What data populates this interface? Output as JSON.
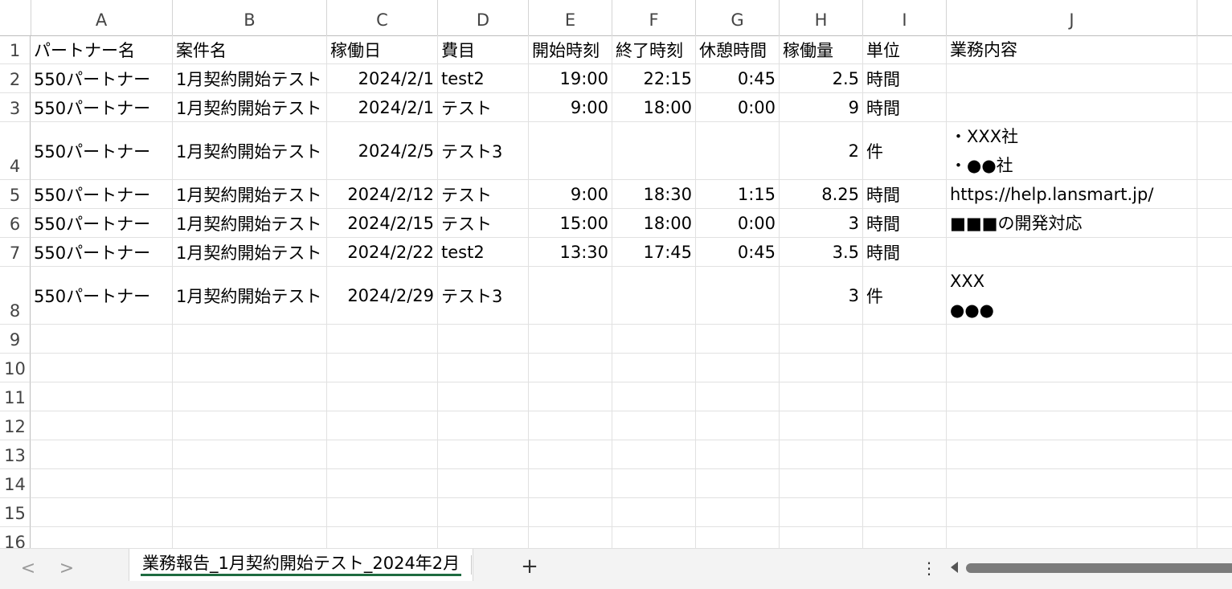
{
  "columns": [
    "A",
    "B",
    "C",
    "D",
    "E",
    "F",
    "G",
    "H",
    "I",
    "J"
  ],
  "rows": [
    {
      "num": "1",
      "cells": [
        "パートナー名",
        "案件名",
        "稼働日",
        "費目",
        "開始時刻",
        "終了時刻",
        "休憩時間",
        "稼働量",
        "単位",
        [
          "業務内容"
        ]
      ]
    },
    {
      "num": "2",
      "cells": [
        "550パートナー",
        "1月契約開始テスト",
        "2024/2/1",
        "test2",
        "19:00",
        "22:15",
        "0:45",
        "2.5",
        "時間",
        []
      ]
    },
    {
      "num": "3",
      "cells": [
        "550パートナー",
        "1月契約開始テスト",
        "2024/2/1",
        "テスト",
        "9:00",
        "18:00",
        "0:00",
        "9",
        "時間",
        []
      ]
    },
    {
      "num": "4",
      "cells": [
        "550パートナー",
        "1月契約開始テスト",
        "2024/2/5",
        "テスト3",
        "",
        "",
        "",
        "2",
        "件",
        [
          "・XXX社",
          "・●●社"
        ]
      ]
    },
    {
      "num": "5",
      "cells": [
        "550パートナー",
        "1月契約開始テスト",
        "2024/2/12",
        "テスト",
        "9:00",
        "18:30",
        "1:15",
        "8.25",
        "時間",
        [
          "https://help.lansmart.jp/"
        ]
      ]
    },
    {
      "num": "6",
      "cells": [
        "550パートナー",
        "1月契約開始テスト",
        "2024/2/15",
        "テスト",
        "15:00",
        "18:00",
        "0:00",
        "3",
        "時間",
        [
          "■■■の開発対応"
        ]
      ]
    },
    {
      "num": "7",
      "cells": [
        "550パートナー",
        "1月契約開始テスト",
        "2024/2/22",
        "test2",
        "13:30",
        "17:45",
        "0:45",
        "3.5",
        "時間",
        []
      ]
    },
    {
      "num": "8",
      "cells": [
        "550パートナー",
        "1月契約開始テスト",
        "2024/2/29",
        "テスト3",
        "",
        "",
        "",
        "3",
        "件",
        [
          "XXX",
          "●●●"
        ]
      ]
    },
    {
      "num": "9",
      "cells": [
        "",
        "",
        "",
        "",
        "",
        "",
        "",
        "",
        "",
        []
      ]
    },
    {
      "num": "10",
      "cells": [
        "",
        "",
        "",
        "",
        "",
        "",
        "",
        "",
        "",
        []
      ]
    },
    {
      "num": "11",
      "cells": [
        "",
        "",
        "",
        "",
        "",
        "",
        "",
        "",
        "",
        []
      ]
    },
    {
      "num": "12",
      "cells": [
        "",
        "",
        "",
        "",
        "",
        "",
        "",
        "",
        "",
        []
      ]
    },
    {
      "num": "13",
      "cells": [
        "",
        "",
        "",
        "",
        "",
        "",
        "",
        "",
        "",
        []
      ]
    },
    {
      "num": "14",
      "cells": [
        "",
        "",
        "",
        "",
        "",
        "",
        "",
        "",
        "",
        []
      ]
    },
    {
      "num": "15",
      "cells": [
        "",
        "",
        "",
        "",
        "",
        "",
        "",
        "",
        "",
        []
      ]
    },
    {
      "num": "16",
      "cells": [
        "",
        "",
        "",
        "",
        "",
        "",
        "",
        "",
        "",
        []
      ]
    }
  ],
  "tabs": {
    "prev_label": "<",
    "next_label": ">",
    "active_sheet": "業務報告_1月契約開始テスト_2024年2月",
    "add_label": "+",
    "more_label": "⋮"
  },
  "colors": {
    "tab_underline": "#1e6b40",
    "grid": "#e1e1e1"
  }
}
